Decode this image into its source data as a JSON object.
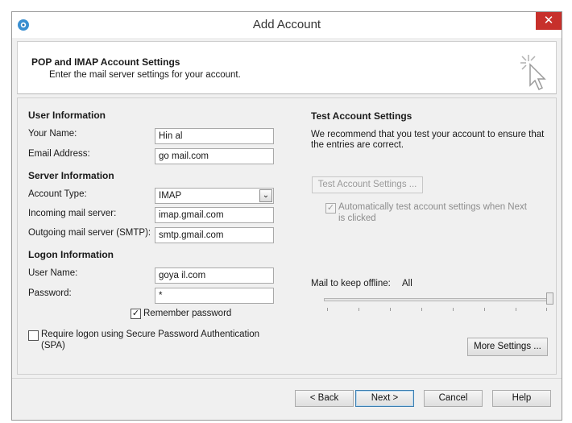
{
  "window": {
    "title": "Add Account",
    "close_label": "✕"
  },
  "header": {
    "title": "POP and IMAP Account Settings",
    "subtitle": "Enter the mail server settings for your account."
  },
  "user_info": {
    "heading": "User Information",
    "your_name_label": "Your Name:",
    "your_name_value": "Hin                    al",
    "email_label": "Email Address:",
    "email_value": "go                        mail.com"
  },
  "server_info": {
    "heading": "Server Information",
    "account_type_label": "Account Type:",
    "account_type_value": "IMAP",
    "incoming_label": "Incoming mail server:",
    "incoming_value": "imap.gmail.com",
    "outgoing_label": "Outgoing mail server (SMTP):",
    "outgoing_value": "smtp.gmail.com"
  },
  "logon_info": {
    "heading": "Logon Information",
    "username_label": "User Name:",
    "username_value": "goya                       il.com",
    "password_label": "Password:",
    "password_value": "*",
    "remember_label": "Remember password",
    "remember_checked": true,
    "spa_label_line1": "Require logon using Secure Password Authentication",
    "spa_label_line2": "(SPA)",
    "spa_checked": false
  },
  "test_settings": {
    "heading": "Test Account Settings",
    "description_line1": "We recommend that you test your account to ensure that",
    "description_line2": "the entries are correct.",
    "test_button": "Test Account Settings ...",
    "auto_test_line1": "Automatically test account settings when Next",
    "auto_test_line2": "is clicked",
    "auto_test_checked": true
  },
  "offline": {
    "label": "Mail to keep offline:",
    "value": "All",
    "level": 1.0
  },
  "more_settings_button": "More Settings ...",
  "footer": {
    "back": "< Back",
    "next": "Next >",
    "cancel": "Cancel",
    "help": "Help"
  },
  "icons": {
    "app": "outlook-icon",
    "header": "click-cursor-icon"
  },
  "colors": {
    "close_button": "#c7302b",
    "default_button_border": "#3c7fb1"
  }
}
